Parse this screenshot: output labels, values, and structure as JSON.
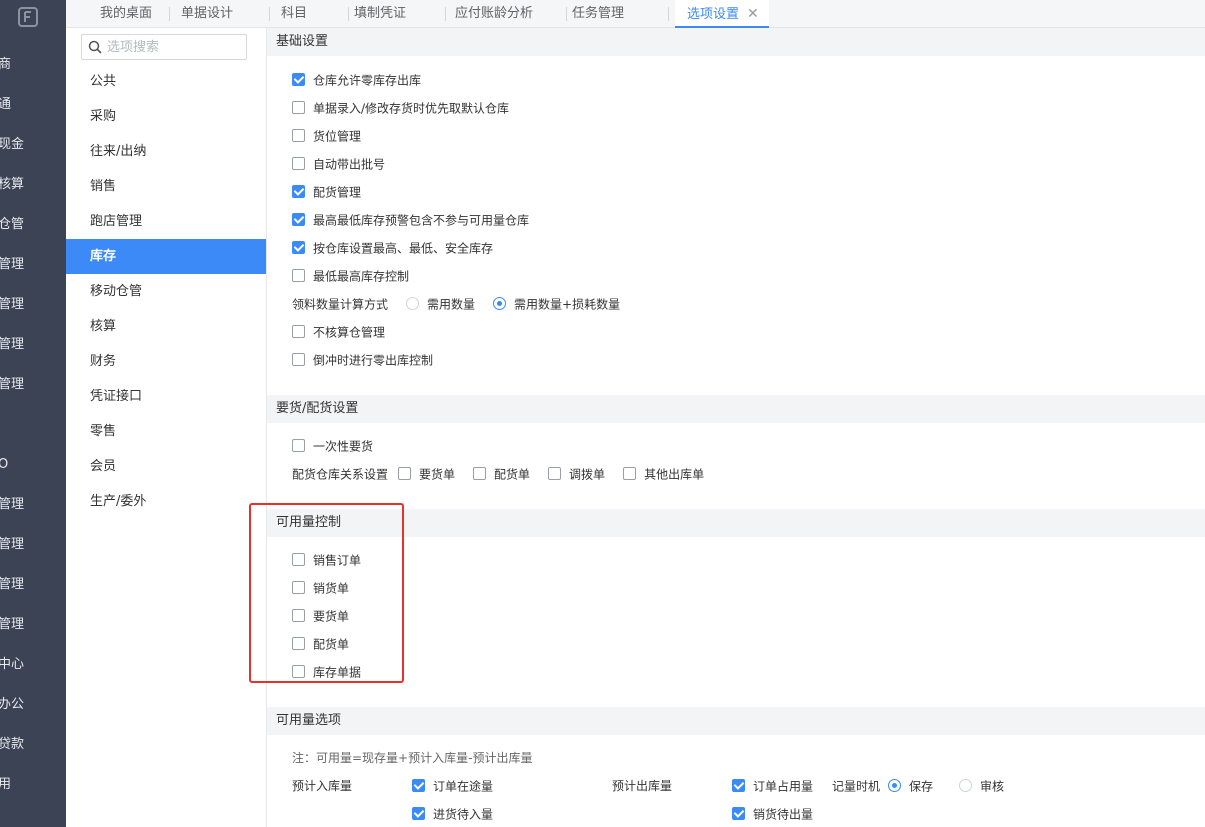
{
  "leftnav": {
    "items": [
      "商",
      "通",
      "现金",
      "核算",
      "仓管",
      "管理",
      "管理",
      "管理",
      "管理",
      "O",
      "管理",
      "管理",
      "管理",
      "管理",
      "中心",
      "办公",
      "贷款",
      "用"
    ]
  },
  "tabs": [
    "我的桌面",
    "单据设计",
    "科目",
    "填制凭证",
    "应付账龄分析",
    "任务管理",
    "选项设置"
  ],
  "tab_close": "✕",
  "search": {
    "placeholder": "选项搜索"
  },
  "menu": [
    "公共",
    "采购",
    "往来/出纳",
    "销售",
    "跑店管理",
    "库存",
    "移动仓管",
    "核算",
    "财务",
    "凭证接口",
    "零售",
    "会员",
    "生产/委外"
  ],
  "basic": {
    "title": "基础设置",
    "options": [
      {
        "label": "仓库允许零库存出库",
        "checked": true
      },
      {
        "label": "单据录入/修改存货时优先取默认仓库",
        "checked": false
      },
      {
        "label": "货位管理",
        "checked": false
      },
      {
        "label": "自动带出批号",
        "checked": false
      },
      {
        "label": "配货管理",
        "checked": true
      },
      {
        "label": "最高最低库存预警包含不参与可用量仓库",
        "checked": true
      },
      {
        "label": "按仓库设置最高、最低、安全库存",
        "checked": true
      },
      {
        "label": "最低最高库存控制",
        "checked": false
      }
    ],
    "calc": {
      "label": "领料数量计算方式",
      "opt1": "需用数量",
      "opt2": "需用数量+损耗数量",
      "selected": 2
    },
    "options2": [
      {
        "label": "不核算仓管理",
        "checked": false
      },
      {
        "label": "倒冲时进行零出库控制",
        "checked": false
      }
    ]
  },
  "request": {
    "title": "要货/配货设置",
    "once": "一次性要货",
    "relation_label": "配货仓库关系设置",
    "relation": [
      "要货单",
      "配货单",
      "调拨单",
      "其他出库单"
    ]
  },
  "avail_control": {
    "title": "可用量控制",
    "options": [
      "销售订单",
      "销货单",
      "要货单",
      "配货单",
      "库存单据"
    ]
  },
  "avail_options": {
    "title": "可用量选项",
    "note": "注：可用量=现存量+预计入库量-预计出库量",
    "in_label": "预计入库量",
    "in_items": [
      "订单在途量",
      "进货待入量"
    ],
    "out_label": "预计出库量",
    "out_items": [
      "订单占用量",
      "销货待出量"
    ],
    "timing_label": "记量时机",
    "timing_opt1": "保存",
    "timing_opt2": "审核"
  }
}
